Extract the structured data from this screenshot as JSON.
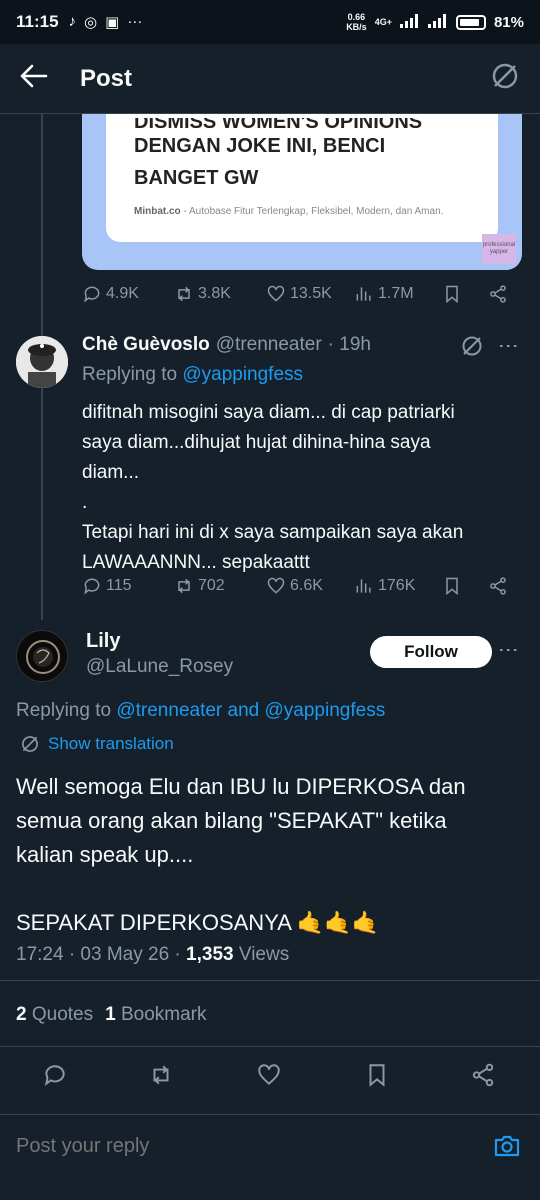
{
  "status": {
    "time": "11:15",
    "net_speed_top": "0.66",
    "net_speed_bottom": "KB/s",
    "network": "4G+",
    "battery": "81%"
  },
  "header": {
    "title": "Post"
  },
  "quoted_card": {
    "headline_cut": "DISMISS WOMEN'S OPINIONS",
    "headline_line1": "DENGAN JOKE INI, BENCI",
    "headline_line2": "BANGET GW",
    "footer_site": "Minbat.co",
    "footer_text": " - Autobase Fitur Terlengkap, Fleksibel, Modern, dan Aman.",
    "badge": "professional yapper"
  },
  "parent_stats": {
    "replies": "4.9K",
    "reposts": "3.8K",
    "likes": "13.5K",
    "views": "1.7M"
  },
  "reply_tweet": {
    "name": "Chè Guèvoslo",
    "handle": "@trenneater",
    "time": "· 19h",
    "replying_prefix": "Replying to ",
    "replying_to": "@yappingfess",
    "line1": "difitnah misogini saya diam... di cap patriarki",
    "line2": "saya diam...dihujat hujat dihina-hina saya",
    "line3": "diam...",
    "line4": ".",
    "line5": "Tetapi hari ini di x saya sampaikan saya akan",
    "line6": "LAWAAANNN... sepakaattt",
    "replies": "115",
    "reposts": "702",
    "likes": "6.6K",
    "views": "176K"
  },
  "main_tweet": {
    "name": "Lily",
    "handle": "@LaLune_Rosey",
    "follow_label": "Follow",
    "replying_prefix": "Replying to ",
    "replying_to_1": "@trenneater",
    "replying_and": " and ",
    "replying_to_2": "@yappingfess",
    "translate_label": "Show translation",
    "text_line1": "Well semoga Elu dan IBU lu DIPERKOSA dan",
    "text_line2": "semua orang akan bilang \"SEPAKAT\" ketika",
    "text_line3": "kalian speak up....",
    "text_line4": "SEPAKAT DIPERKOSANYA 🤙🤙🤙",
    "timestamp": "17:24 · 03 May 26 · ",
    "views_count": "1,353",
    "views_label": " Views",
    "quotes_count": "2",
    "quotes_label": "Quotes",
    "bookmarks_count": "1",
    "bookmarks_label": "Bookmark"
  },
  "reply_bar": {
    "placeholder": "Post your reply"
  },
  "colors": {
    "background": "#15202b",
    "accent": "#1d9bf0",
    "muted": "#8b98a5"
  }
}
